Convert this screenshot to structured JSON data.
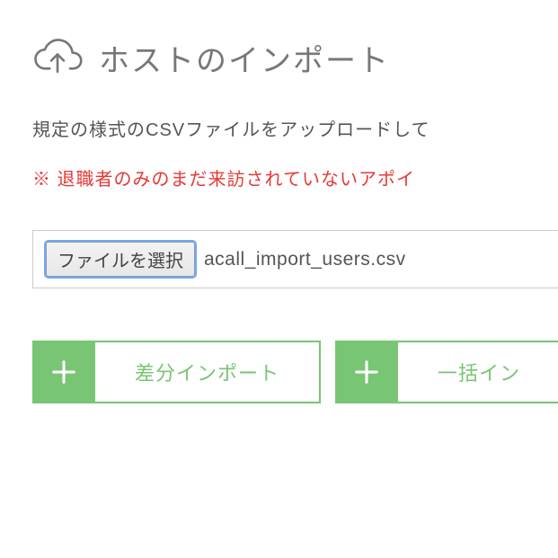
{
  "header": {
    "title": "ホストのインポート"
  },
  "description": "規定の様式のCSVファイルをアップロードして",
  "warning": "※ 退職者のみのまだ来訪されていないアポイ",
  "file": {
    "button_label": "ファイルを選択",
    "name": "acall_import_users.csv"
  },
  "buttons": {
    "diff_import": "差分インポート",
    "bulk_import": "一括イン"
  }
}
